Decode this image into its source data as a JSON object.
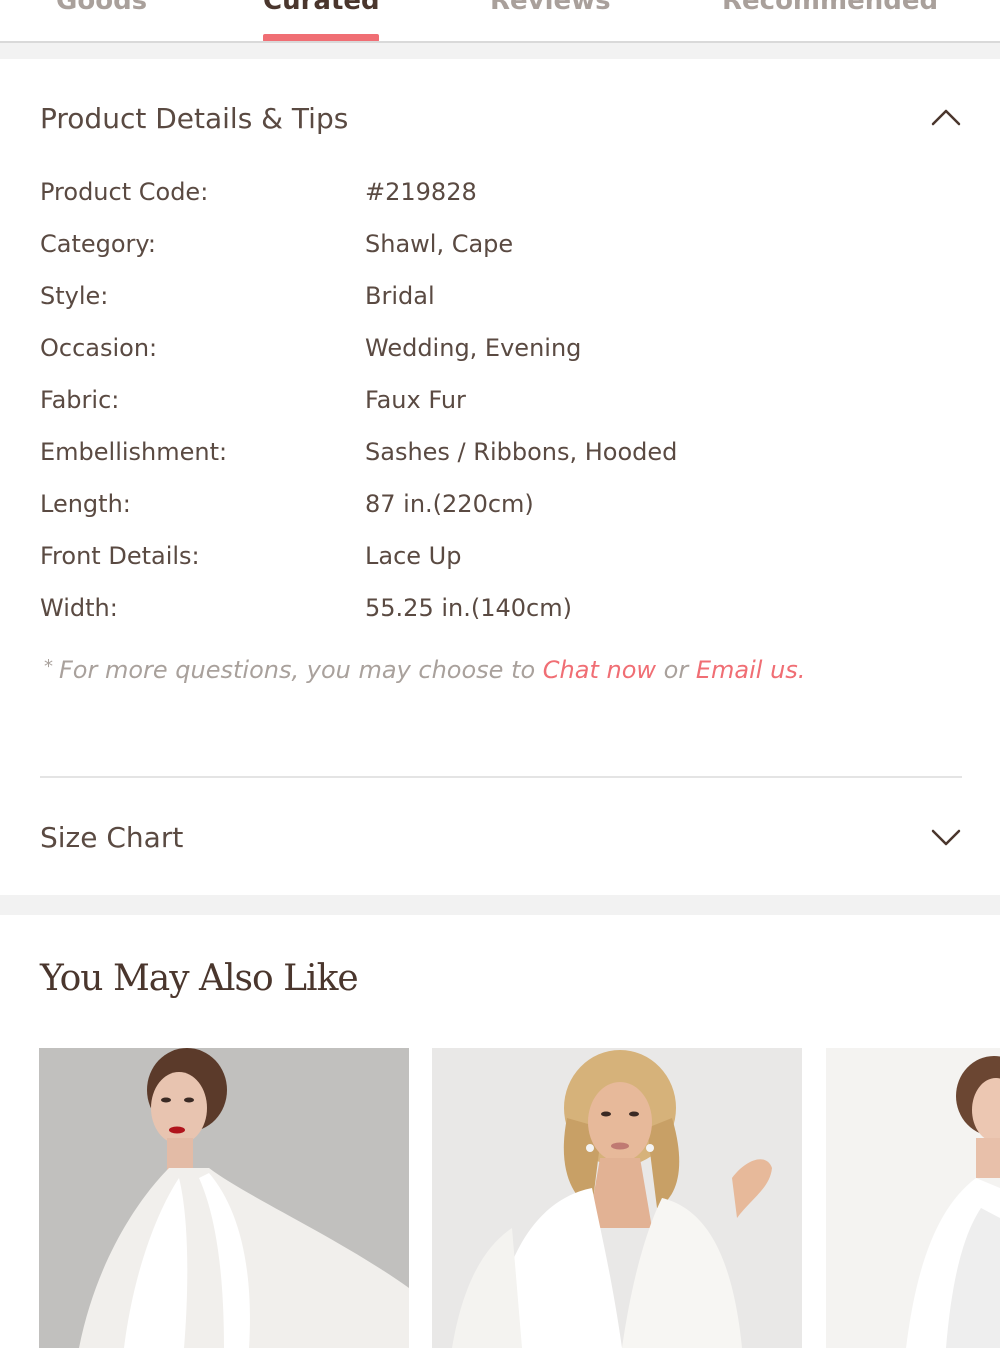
{
  "tabs": [
    {
      "label": "Goods"
    },
    {
      "label": "Curated"
    },
    {
      "label": "Reviews"
    },
    {
      "label": "Recommended"
    }
  ],
  "active_tab": "Curated",
  "details": {
    "title": "Product Details & Tips",
    "rows": [
      {
        "label": "Product Code:",
        "value": "#219828"
      },
      {
        "label": "Category:",
        "value": "Shawl, Cape"
      },
      {
        "label": "Style:",
        "value": "Bridal"
      },
      {
        "label": "Occasion:",
        "value": "Wedding, Evening"
      },
      {
        "label": "Fabric:",
        "value": "Faux Fur"
      },
      {
        "label": "Embellishment:",
        "value": "Sashes / Ribbons, Hooded"
      },
      {
        "label": "Length:",
        "value": "87 in.(220cm)"
      },
      {
        "label": "Front Details:",
        "value": "Lace Up"
      },
      {
        "label": "Width:",
        "value": "55.25 in.(140cm)"
      }
    ],
    "note_star": "*",
    "note_prefix": "For more questions, you may choose to ",
    "chat_link": "Chat now",
    "note_mid": " or ",
    "email_link": "Email us",
    "note_suffix": "."
  },
  "size_chart": {
    "title": "Size Chart"
  },
  "also_like": {
    "title": "You May Also Like"
  },
  "colors": {
    "accent": "#f06e74",
    "text": "#5a4a42",
    "heading": "#4a362d"
  }
}
